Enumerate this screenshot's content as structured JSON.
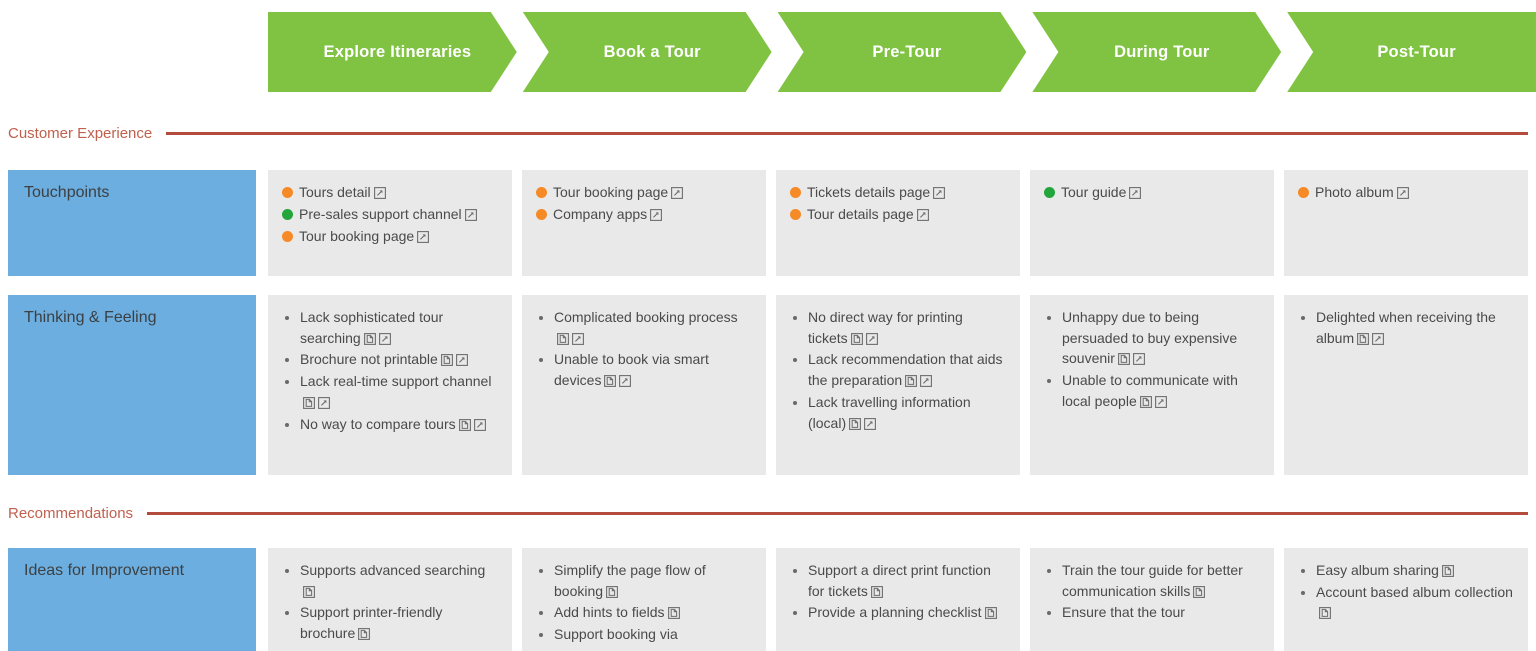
{
  "stages": [
    {
      "label": "Explore Itineraries"
    },
    {
      "label": "Book a Tour"
    },
    {
      "label": "Pre-Tour"
    },
    {
      "label": "During Tour"
    },
    {
      "label": "Post-Tour"
    }
  ],
  "colors": {
    "stage_green": "#80c342",
    "row_label_blue": "#6caedf",
    "cell_grey": "#e9e9e9",
    "divider_red": "#b34b3c",
    "divider_label_red": "#c0604e",
    "dot_orange": "#f58a27",
    "dot_green": "#22a63c"
  },
  "sections": [
    {
      "label": "Customer Experience"
    },
    {
      "label": "Recommendations"
    }
  ],
  "rows": [
    {
      "label": "Touchpoints",
      "type": "touchpoints",
      "cells": [
        {
          "items": [
            {
              "text": "Tours detail",
              "dot": "orange",
              "icons": [
                "external-link-icon"
              ]
            },
            {
              "text": "Pre-sales support channel",
              "dot": "green",
              "icons": [
                "external-link-icon"
              ]
            },
            {
              "text": "Tour booking page",
              "dot": "orange",
              "icons": [
                "external-link-icon"
              ]
            }
          ]
        },
        {
          "items": [
            {
              "text": "Tour booking page",
              "dot": "orange",
              "icons": [
                "external-link-icon"
              ]
            },
            {
              "text": "Company apps",
              "dot": "orange",
              "icons": [
                "external-link-icon"
              ]
            }
          ]
        },
        {
          "items": [
            {
              "text": "Tickets details page",
              "dot": "orange",
              "icons": [
                "external-link-icon"
              ]
            },
            {
              "text": "Tour details page",
              "dot": "orange",
              "icons": [
                "external-link-icon"
              ]
            }
          ]
        },
        {
          "items": [
            {
              "text": "Tour guide",
              "dot": "green",
              "icons": [
                "external-link-icon"
              ]
            }
          ]
        },
        {
          "items": [
            {
              "text": "Photo album",
              "dot": "orange",
              "icons": [
                "external-link-icon"
              ]
            }
          ]
        }
      ]
    },
    {
      "label": "Thinking & Feeling",
      "type": "bullets",
      "cells": [
        {
          "items": [
            {
              "text": "Lack sophisticated tour searching",
              "icons": [
                "note-icon",
                "external-link-icon"
              ]
            },
            {
              "text": "Brochure not printable",
              "icons": [
                "note-icon",
                "external-link-icon"
              ]
            },
            {
              "text": "Lack real-time support channel",
              "icons": [
                "note-icon",
                "external-link-icon"
              ]
            },
            {
              "text": "No way to compare tours",
              "icons": [
                "note-icon",
                "external-link-icon"
              ]
            }
          ]
        },
        {
          "items": [
            {
              "text": "Complicated booking process",
              "icons": [
                "note-icon",
                "external-link-icon"
              ]
            },
            {
              "text": "Unable to book via smart devices",
              "icons": [
                "note-icon",
                "external-link-icon"
              ]
            }
          ]
        },
        {
          "items": [
            {
              "text": "No direct way for printing tickets",
              "icons": [
                "note-icon",
                "external-link-icon"
              ]
            },
            {
              "text": "Lack recommendation that aids the preparation",
              "icons": [
                "note-icon",
                "external-link-icon"
              ]
            },
            {
              "text": "Lack travelling information (local)",
              "icons": [
                "note-icon",
                "external-link-icon"
              ]
            }
          ]
        },
        {
          "items": [
            {
              "text": "Unhappy due to being persuaded to buy expensive souvenir",
              "icons": [
                "note-icon",
                "external-link-icon"
              ]
            },
            {
              "text": "Unable to communicate with local people",
              "icons": [
                "note-icon",
                "external-link-icon"
              ]
            }
          ]
        },
        {
          "items": [
            {
              "text": "Delighted when receiving the album",
              "icons": [
                "note-icon",
                "external-link-icon"
              ]
            }
          ]
        }
      ]
    },
    {
      "label": "Ideas for Improvement",
      "type": "bullets",
      "cells": [
        {
          "items": [
            {
              "text": "Supports advanced searching",
              "icons": [
                "note-icon"
              ]
            },
            {
              "text": "Support printer-friendly brochure",
              "icons": [
                "note-icon"
              ]
            }
          ]
        },
        {
          "items": [
            {
              "text": "Simplify the page flow of booking",
              "icons": [
                "note-icon"
              ]
            },
            {
              "text": "Add hints to fields",
              "icons": [
                "note-icon"
              ]
            },
            {
              "text": "Support booking via",
              "icons": []
            }
          ]
        },
        {
          "items": [
            {
              "text": "Support a direct print function for tickets",
              "icons": [
                "note-icon"
              ]
            },
            {
              "text": "Provide a planning checklist",
              "icons": [
                "note-icon"
              ]
            }
          ]
        },
        {
          "items": [
            {
              "text": "Train the tour guide for better communication skills",
              "icons": [
                "note-icon"
              ]
            },
            {
              "text": "Ensure that the tour",
              "icons": []
            }
          ]
        },
        {
          "items": [
            {
              "text": "Easy album sharing",
              "icons": [
                "note-icon"
              ]
            },
            {
              "text": "Account based album collection",
              "icons": [
                "note-icon"
              ]
            }
          ]
        }
      ]
    }
  ]
}
